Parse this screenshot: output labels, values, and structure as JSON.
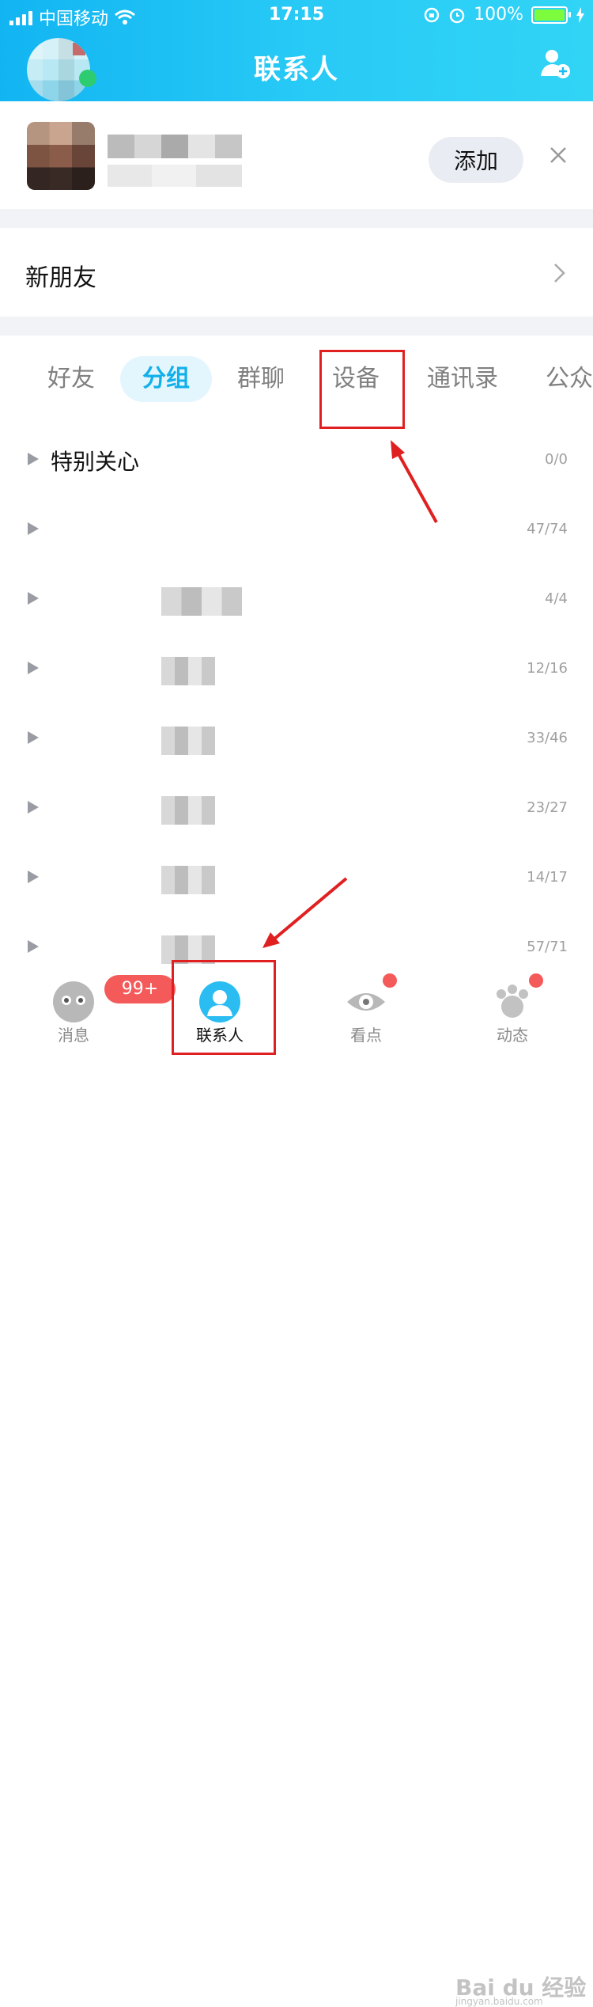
{
  "status_bar": {
    "carrier": "中国移动",
    "time": "17:15",
    "battery": "100%"
  },
  "header": {
    "title": "联系人"
  },
  "recommend": {
    "add_label": "添加",
    "close_symbol": "✕"
  },
  "new_friend": {
    "label": "新朋友"
  },
  "tabs": [
    {
      "label": "好友",
      "active": false
    },
    {
      "label": "分组",
      "active": true
    },
    {
      "label": "群聊",
      "active": false
    },
    {
      "label": "设备",
      "active": false
    },
    {
      "label": "通讯录",
      "active": false
    },
    {
      "label": "公众",
      "active": false
    }
  ],
  "groups": [
    {
      "name": "特别关心",
      "count": "0/0"
    },
    {
      "name": "",
      "count": "47/74"
    },
    {
      "name": "",
      "count": "4/4"
    },
    {
      "name": "",
      "count": "12/16"
    },
    {
      "name": "",
      "count": "33/46"
    },
    {
      "name": "",
      "count": "23/27"
    },
    {
      "name": "",
      "count": "14/17"
    },
    {
      "name": "",
      "count": "57/71"
    }
  ],
  "tabbar": {
    "items": [
      {
        "label": "消息",
        "icon": "message-icon",
        "badge": "99+"
      },
      {
        "label": "联系人",
        "icon": "contacts-icon"
      },
      {
        "label": "看点",
        "icon": "eye-icon"
      },
      {
        "label": "动态",
        "icon": "paw-icon"
      }
    ]
  },
  "watermark": {
    "text": "Bai du 经验",
    "sub": "jingyan.baidu.com"
  },
  "colors": {
    "accent": "#12b0ea",
    "header_start": "#12b5f2",
    "annotation_red": "#e02020",
    "badge_red": "#f45a5a"
  }
}
